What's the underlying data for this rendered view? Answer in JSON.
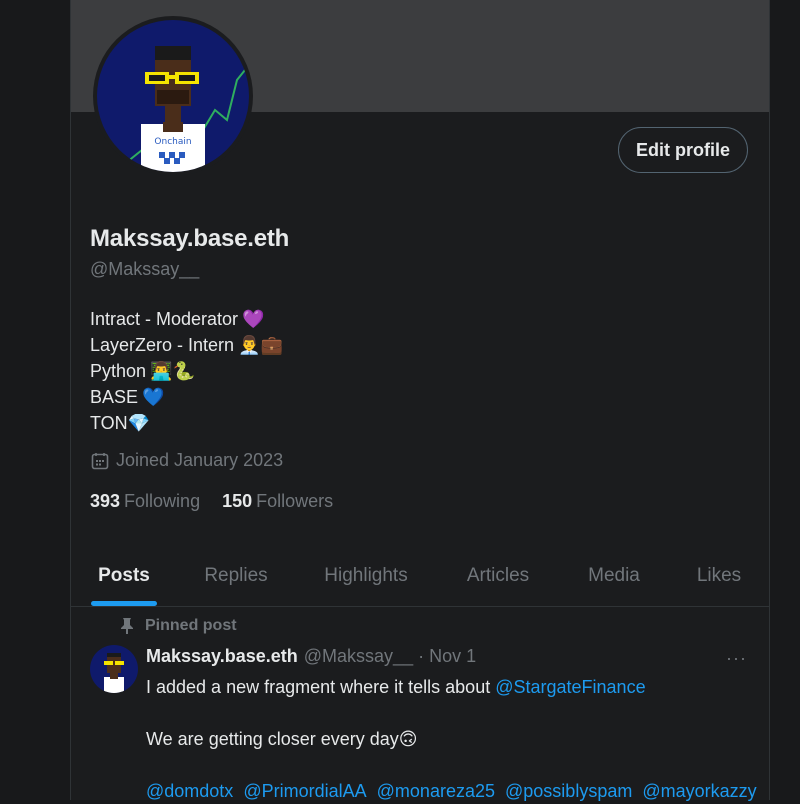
{
  "profile": {
    "edit_button": "Edit profile",
    "display_name": "Makssay.base.eth",
    "handle": "@Makssay__",
    "bio": [
      {
        "text": "Intract - Moderator",
        "emoji": "💜",
        "emoji_class": "heart-purple"
      },
      {
        "text": "LayerZero - Intern",
        "emoji": "👨‍💼💼",
        "emoji_class": ""
      },
      {
        "text": "Python",
        "emoji": "👨‍💻🐍",
        "emoji_class": ""
      },
      {
        "text": "BASE",
        "emoji": "💙",
        "emoji_class": "heart-blue"
      },
      {
        "text": "TON",
        "emoji": "💎",
        "emoji_class": "gem"
      }
    ],
    "joined": "Joined January 2023",
    "following_count": "393",
    "following_label": "Following",
    "followers_count": "150",
    "followers_label": "Followers",
    "avatar_shirt_text": "Onchain"
  },
  "tabs": [
    "Posts",
    "Replies",
    "Highlights",
    "Articles",
    "Media",
    "Likes"
  ],
  "active_tab": "Posts",
  "post": {
    "pinned_label": "Pinned post",
    "author_name": "Makssay.base.eth",
    "author_handle": "@Makssay__",
    "separator": "·",
    "date": "Nov 1",
    "more": "···",
    "line1_text": "I added a new fragment where it tells about ",
    "line1_link": "@StargateFinance",
    "line2_text": "We are getting closer every day",
    "line2_emoji": "🙃",
    "mentions": [
      "@domdotx",
      "@PrimordialAA",
      "@monareza25",
      "@possiblyspam",
      "@mayorkazzy"
    ]
  },
  "colors": {
    "background": "#18191b",
    "accent": "#1d9bf0",
    "muted_text": "#71767b",
    "primary_text": "#e7e9ea",
    "banner": "#3c3d3f"
  }
}
